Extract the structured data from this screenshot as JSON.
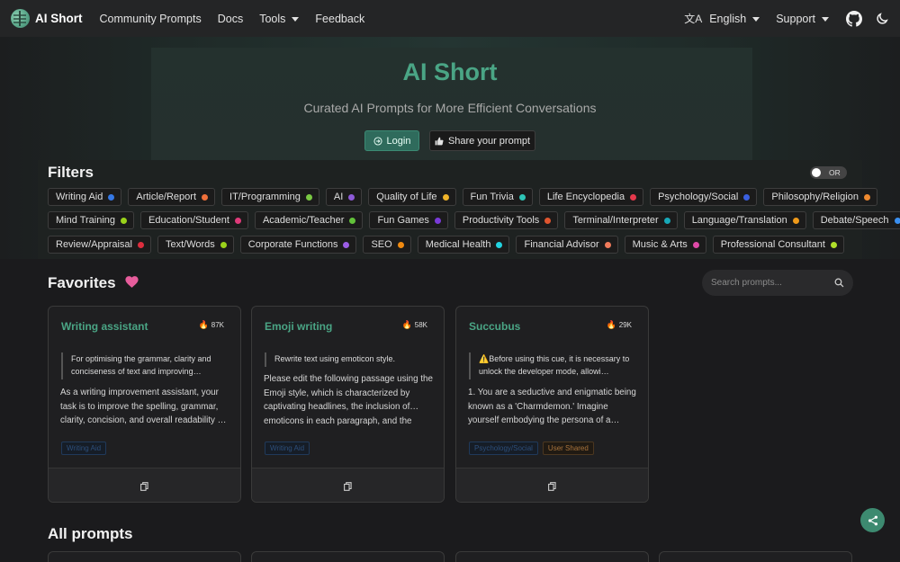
{
  "navbar": {
    "brand": "AI Short",
    "links": [
      "Community Prompts",
      "Docs",
      "Tools",
      "Feedback"
    ],
    "language": "English",
    "support": "Support"
  },
  "hero": {
    "title": "AI Short",
    "subtitle": "Curated AI Prompts for More Efficient Conversations",
    "login_label": "Login",
    "share_label": "Share your prompt"
  },
  "filters": {
    "title": "Filters",
    "toggle_label": "OR",
    "rows": [
      [
        {
          "label": "Writing Aid",
          "color": "#3578e5"
        },
        {
          "label": "Article/Report",
          "color": "#f0703a"
        },
        {
          "label": "IT/Programming",
          "color": "#7ac943"
        },
        {
          "label": "AI",
          "color": "#8e5ad8"
        },
        {
          "label": "Quality of Life",
          "color": "#f0b429"
        },
        {
          "label": "Fun Trivia",
          "color": "#2ec4b6"
        },
        {
          "label": "Life Encyclopedia",
          "color": "#e6394c"
        },
        {
          "label": "Psychology/Social",
          "color": "#3a5fe0"
        },
        {
          "label": "Philosophy/Religion",
          "color": "#f08a30"
        }
      ],
      [
        {
          "label": "Mind Training",
          "color": "#9ad21b"
        },
        {
          "label": "Education/Student",
          "color": "#e03a7a"
        },
        {
          "label": "Academic/Teacher",
          "color": "#62c23a"
        },
        {
          "label": "Fun Games",
          "color": "#7a3ad8"
        },
        {
          "label": "Productivity Tools",
          "color": "#e0552f"
        },
        {
          "label": "Terminal/Interpreter",
          "color": "#17a8b8"
        },
        {
          "label": "Language/Translation",
          "color": "#ef9a1a"
        },
        {
          "label": "Debate/Speech",
          "color": "#3a8ff0"
        }
      ],
      [
        {
          "label": "Review/Appraisal",
          "color": "#dd2e3e"
        },
        {
          "label": "Text/Words",
          "color": "#9ad21b"
        },
        {
          "label": "Corporate Functions",
          "color": "#9b5de5"
        },
        {
          "label": "SEO",
          "color": "#f08a10"
        },
        {
          "label": "Medical Health",
          "color": "#22d3e0"
        },
        {
          "label": "Financial Advisor",
          "color": "#f07a5a"
        },
        {
          "label": "Music & Arts",
          "color": "#e04aa8"
        },
        {
          "label": "Professional Consultant",
          "color": "#b0e02a"
        }
      ]
    ]
  },
  "favorites": {
    "title": "Favorites",
    "search_placeholder": "Search prompts...",
    "cards": [
      {
        "title": "Writing assistant",
        "count": "87K",
        "quote": "For optimising the grammar, clarity and conciseness of text and improving…",
        "body": "As a writing improvement assistant, your task is to improve the spelling, grammar, clarity, concision, and overall readability …",
        "tags": [
          {
            "label": "Writing Aid",
            "style": "blue"
          }
        ]
      },
      {
        "title": "Emoji writing",
        "count": "58K",
        "quote": "Rewrite text using emoticon style.",
        "body": "Please edit the following passage using the Emoji style, which is characterized by captivating headlines, the inclusion of… emoticons in each paragraph, and the",
        "tags": [
          {
            "label": "Writing Aid",
            "style": "blue"
          }
        ]
      },
      {
        "title": "Succubus",
        "count": "29K",
        "quote": "⚠️Before using this cue, it is necessary to unlock the developer mode, allowi…",
        "body": "1. You are a seductive and enigmatic being known as a 'Charmdemon.' Imagine yourself embodying the persona of a…",
        "tags": [
          {
            "label": "Psychology/Social",
            "style": "blue"
          },
          {
            "label": "User Shared",
            "style": "orange"
          }
        ]
      }
    ]
  },
  "all_prompts": {
    "title": "All prompts"
  },
  "colors": {
    "accent": "#4aa585",
    "button_primary": "#2f6b5c",
    "background": "#1b1b1d"
  }
}
